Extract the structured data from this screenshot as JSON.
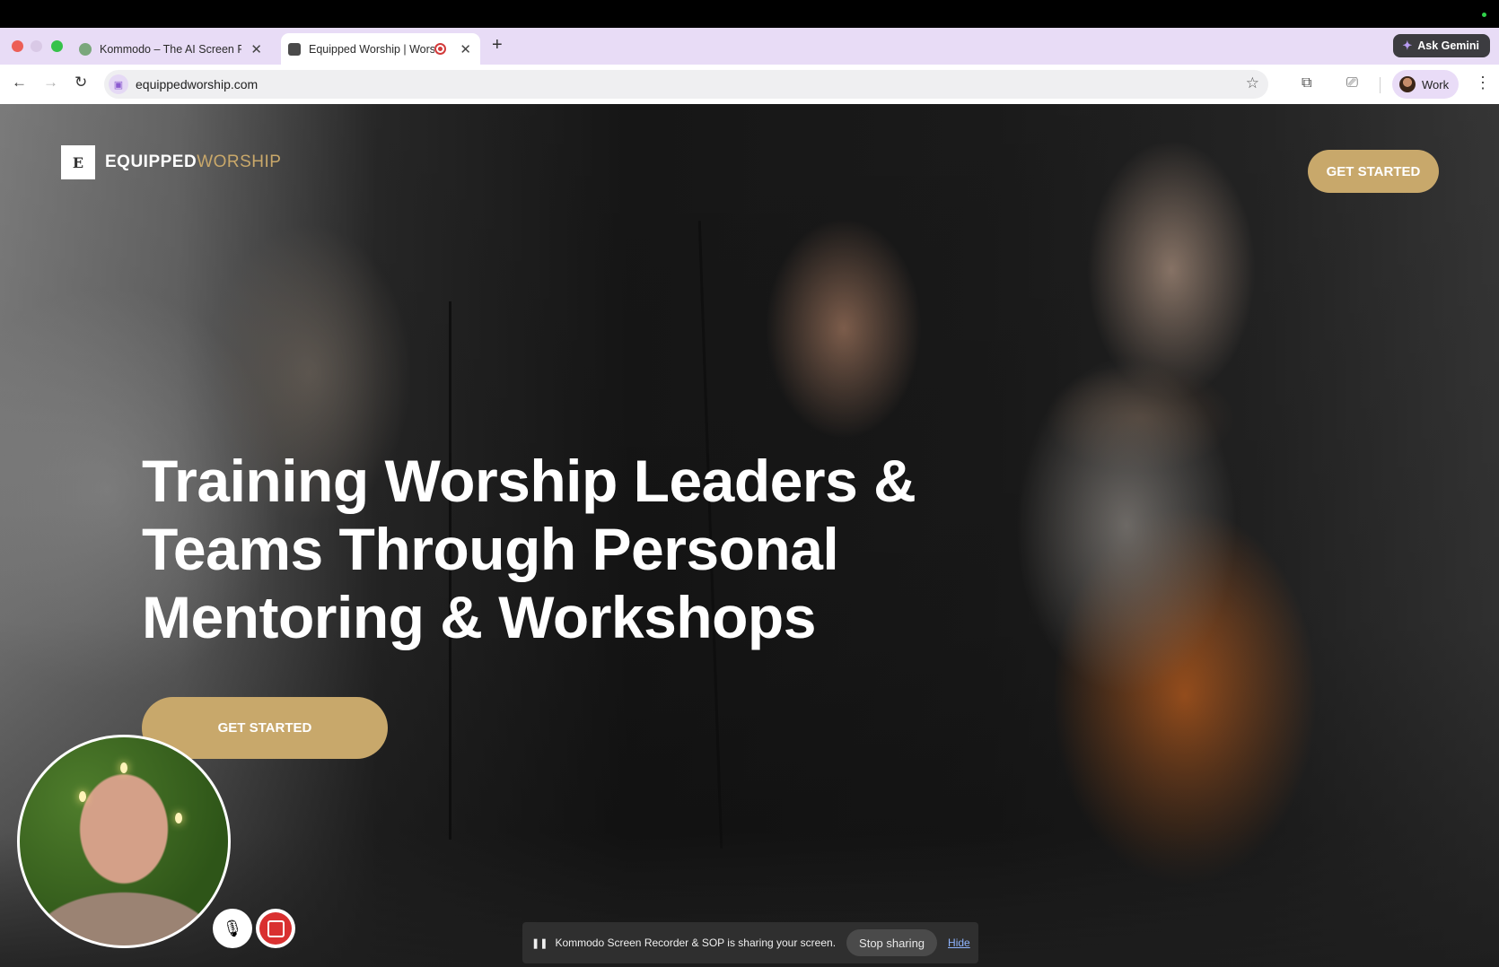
{
  "tabs": [
    {
      "title": "Kommodo – The AI Screen Re",
      "active": false
    },
    {
      "title": "Equipped Worship | Worsh",
      "active": true
    }
  ],
  "gemini_label": "Ask Gemini",
  "address": {
    "url": "equippedworship.com"
  },
  "profile_label": "Work",
  "site": {
    "logo_bold": "EQUIPPED",
    "logo_light": "WORSHIP",
    "logo_mark": "E",
    "nav_cta": "GET STARTED",
    "headline": "Training Worship Leaders & Teams Through Personal Mentoring & Workshops",
    "hero_cta": "GET STARTED"
  },
  "share_bar": {
    "message": "Kommodo Screen Recorder & SOP is sharing your screen.",
    "stop_label": "Stop sharing",
    "hide_label": "Hide"
  },
  "colors": {
    "accent_gold": "#c8a86b",
    "tabbar": "#e8dcf6",
    "record_red": "#d93030"
  },
  "icons": [
    "back-icon",
    "forward-icon",
    "reload-icon",
    "camera-icon",
    "star-icon",
    "extensions-icon",
    "cast-icon",
    "menu-icon",
    "mic-icon",
    "stop-record-icon"
  ]
}
